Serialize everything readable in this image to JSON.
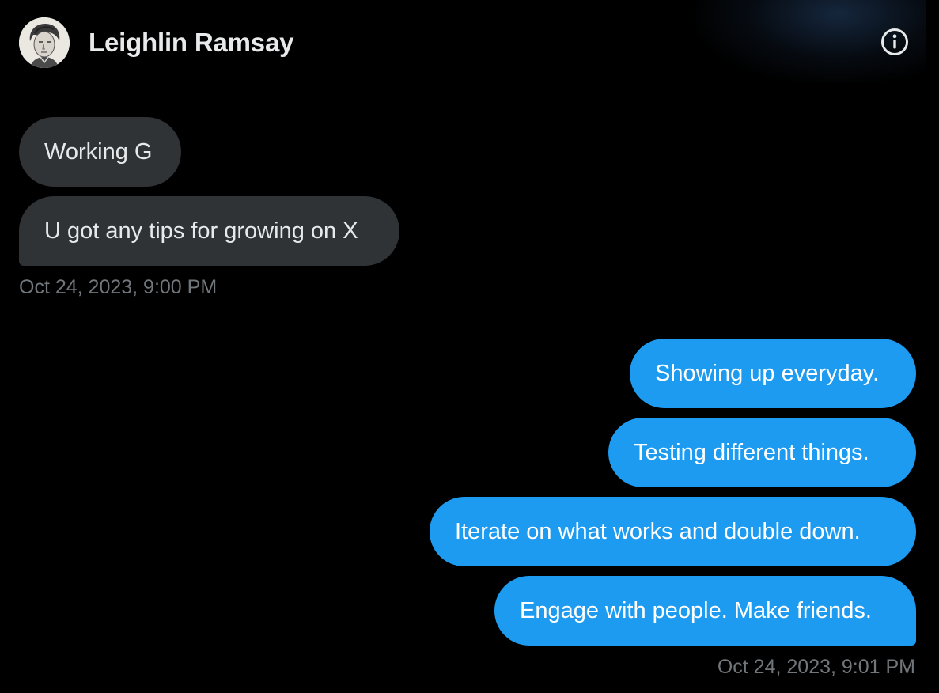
{
  "header": {
    "name": "Leighlin Ramsay",
    "avatar_icon": "user-avatar-sketch",
    "info_icon": "info-circle-icon"
  },
  "conversation": {
    "received": {
      "messages": [
        "Working G",
        "U got any tips for growing on X"
      ],
      "timestamp": "Oct 24, 2023, 9:00 PM"
    },
    "sent": {
      "messages": [
        "Showing up everyday.",
        "Testing different things.",
        "Iterate on what works and double down.",
        "Engage with people. Make friends."
      ],
      "timestamp": "Oct 24, 2023, 9:01 PM"
    }
  },
  "colors": {
    "background": "#000000",
    "received_bubble": "#2f3336",
    "sent_bubble": "#1d9bf0",
    "timestamp": "#71767b",
    "text": "#e7e9ea"
  }
}
